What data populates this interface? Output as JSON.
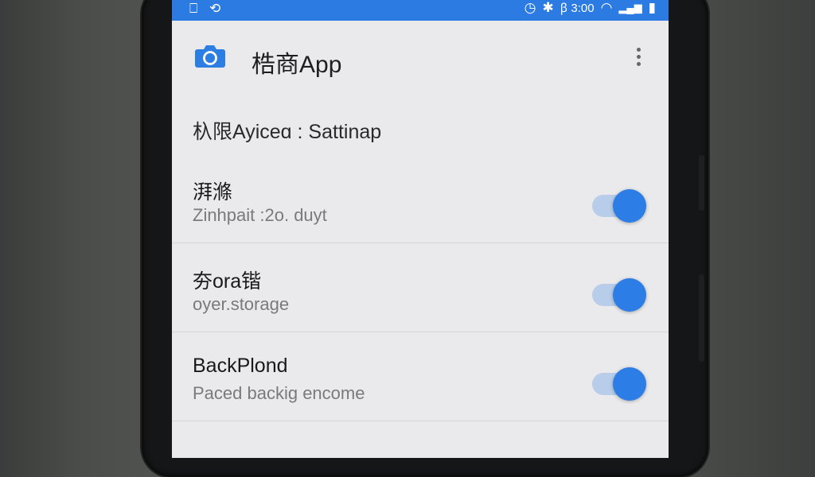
{
  "status_bar": {
    "left_icons": [
      "⎕",
      "⟲"
    ],
    "clock_icon": "◷",
    "bluetooth_icon": "✱",
    "time_text": "ꞵ 3:00",
    "wifi_icon": "◠",
    "signal_icon": "▂▄▆",
    "battery_icon": "▮"
  },
  "app_bar": {
    "title": "梏商App"
  },
  "section": {
    "title": "杁限Ayiceɑ : Sattinap"
  },
  "settings": [
    {
      "title": "湃滌",
      "subtitle": "Zinhpait :2o. duyt",
      "enabled": true
    },
    {
      "title": "夯ora锴",
      "subtitle": "oyer.storage",
      "enabled": true
    },
    {
      "title": "BackPlond",
      "subtitle": "Paced backig encome",
      "enabled": true
    }
  ],
  "colors": {
    "status_bar": "#2b7be2",
    "accent": "#2c7de6",
    "screen_bg": "#eaeaec"
  }
}
